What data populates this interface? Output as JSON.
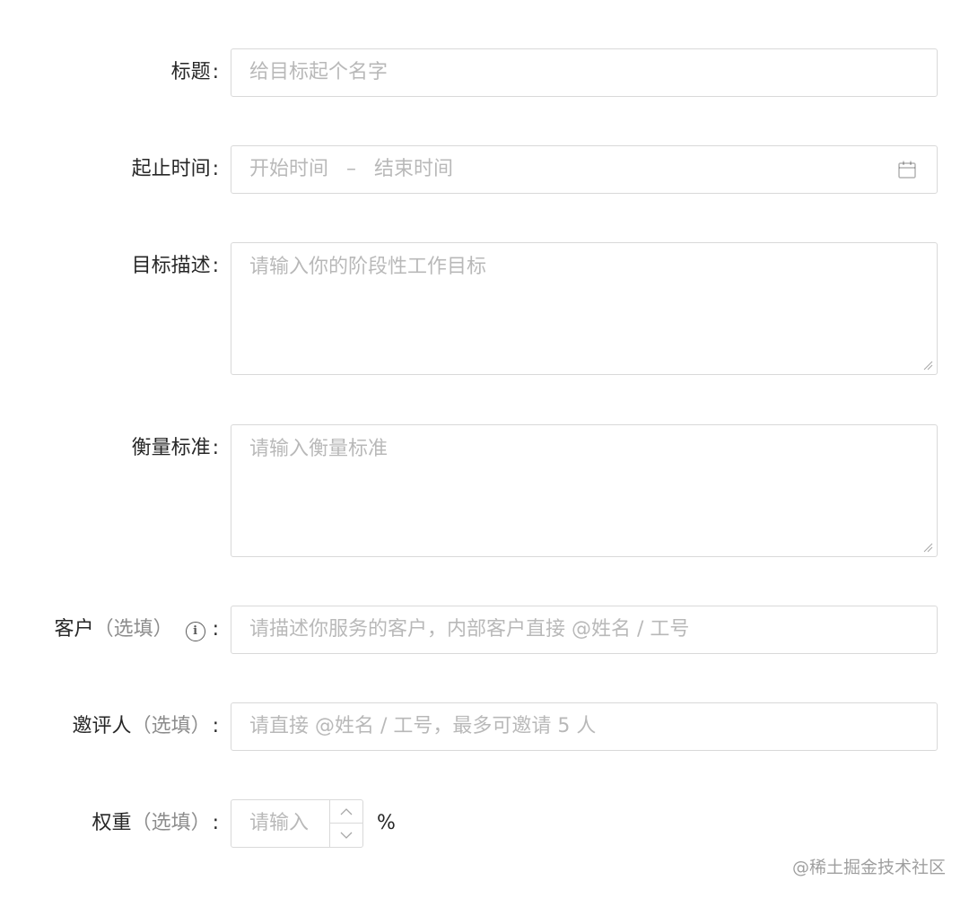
{
  "form": {
    "title": {
      "label": "标题",
      "colon": ":",
      "placeholder": "给目标起个名字"
    },
    "date_range": {
      "label": "起止时间",
      "colon": ":",
      "start_placeholder": "开始时间",
      "separator": "–",
      "end_placeholder": "结束时间",
      "icon": "calendar-icon"
    },
    "description": {
      "label": "目标描述",
      "colon": ":",
      "placeholder": "请输入你的阶段性工作目标"
    },
    "criteria": {
      "label": "衡量标准",
      "colon": ":",
      "placeholder": "请输入衡量标准"
    },
    "client": {
      "label": "客户",
      "optional": "（选填）",
      "info": "i",
      "colon": ":",
      "placeholder": "请描述你服务的客户，内部客户直接 @姓名 / 工号"
    },
    "reviewer": {
      "label": "邀评人",
      "optional": "（选填）",
      "colon": ":",
      "placeholder": "请直接 @姓名 / 工号，最多可邀请 5 人"
    },
    "weight": {
      "label": "权重",
      "optional": "（选填）",
      "colon": ":",
      "placeholder": "请输入",
      "unit": "%"
    }
  },
  "watermark": "@稀土掘金技术社区"
}
